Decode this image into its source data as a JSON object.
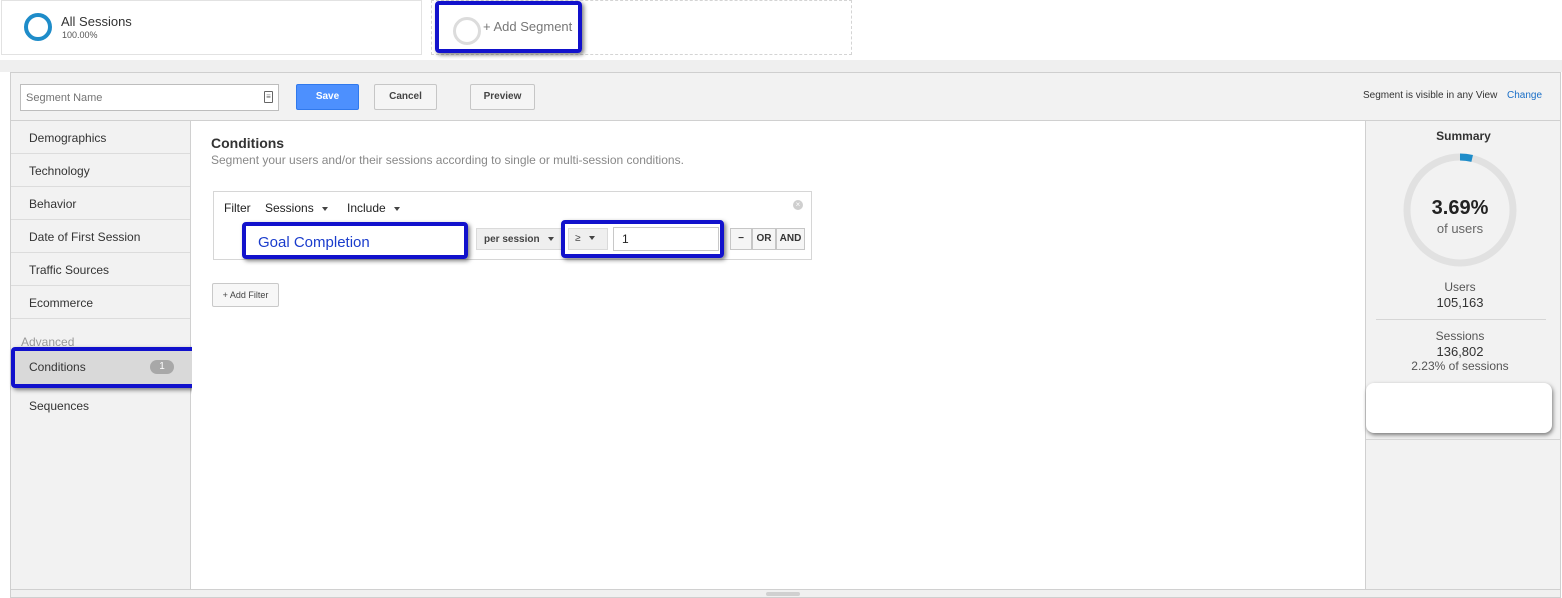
{
  "segments": {
    "all": {
      "title": "All Sessions",
      "percent": "100.00%"
    },
    "add": {
      "label": "+ Add Segment"
    }
  },
  "toolbar": {
    "segment_name_placeholder": "Segment Name",
    "save": "Save",
    "cancel": "Cancel",
    "preview": "Preview",
    "visibility_text": "Segment is visible in any View",
    "change_link": "Change"
  },
  "nav": {
    "items": [
      "Demographics",
      "Technology",
      "Behavior",
      "Date of First Session",
      "Traffic Sources",
      "Ecommerce"
    ],
    "advanced_heading": "Advanced",
    "conditions": {
      "label": "Conditions",
      "badge": "1"
    },
    "sequences": "Sequences"
  },
  "main": {
    "title": "Conditions",
    "subtitle": "Segment your users and/or their sessions according to single or multi-session conditions.",
    "filter": {
      "label": "Filter",
      "scope": "Sessions",
      "mode": "Include",
      "close_icon": "close-circle-icon",
      "dimension": "Goal Completion",
      "per": "per session",
      "operator": "≥",
      "value": "1",
      "minus": "−",
      "or": "OR",
      "and": "AND"
    },
    "add_filter": "+ Add Filter"
  },
  "summary": {
    "title": "Summary",
    "percent": "3.69%",
    "of_users": "of users",
    "percent_fraction": 0.0369,
    "users_label": "Users",
    "users_value": "105,163",
    "sessions_label": "Sessions",
    "sessions_value": "136,802",
    "sessions_pct": "2.23% of sessions"
  },
  "colors": {
    "accent_blue": "#1e8cc9",
    "save_blue": "#4d90fe",
    "highlight": "#1111cc",
    "link": "#1a6fc7"
  }
}
